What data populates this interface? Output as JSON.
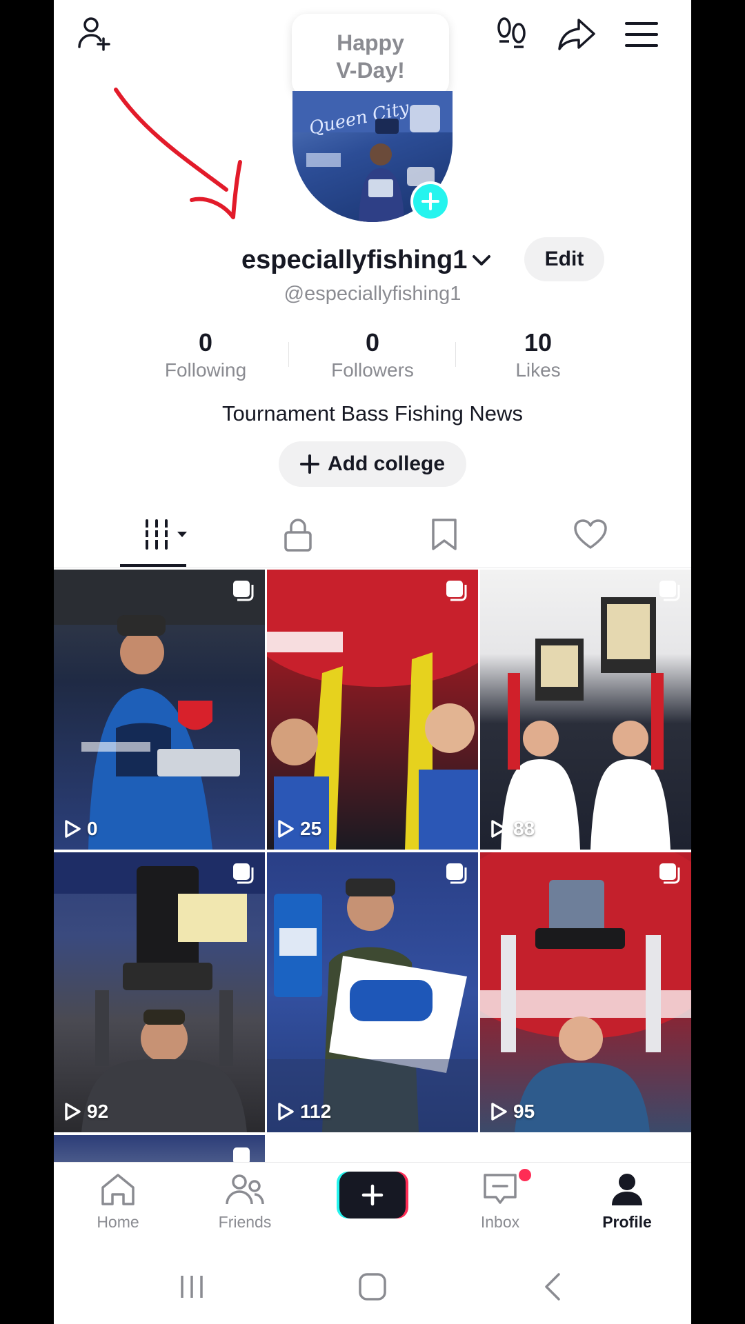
{
  "header": {
    "add_friend_icon": "person-plus-icon",
    "footprints_icon": "footprints-icon",
    "share_icon": "share-arrow-icon",
    "menu_icon": "hamburger-menu-icon",
    "bubble_line1": "Happy",
    "bubble_line2": "V-Day!"
  },
  "profile": {
    "display_name": "especiallyfishing1",
    "username": "@especiallyfishing1",
    "edit_label": "Edit",
    "bio": "Tournament Bass Fishing News",
    "add_college_label": "Add college",
    "stats": {
      "following_count": "0",
      "following_label": "Following",
      "followers_count": "0",
      "followers_label": "Followers",
      "likes_count": "10",
      "likes_label": "Likes"
    }
  },
  "tabs": [
    "videos-grid-icon",
    "lock-icon",
    "bookmark-icon",
    "heart-icon"
  ],
  "grid": [
    {
      "views": "0"
    },
    {
      "views": "25"
    },
    {
      "views": "88"
    },
    {
      "views": "92"
    },
    {
      "views": "112"
    },
    {
      "views": "95"
    }
  ],
  "bottom_nav": {
    "home": "Home",
    "friends": "Friends",
    "inbox": "Inbox",
    "profile": "Profile"
  },
  "colors": {
    "accent_cyan": "#25f4ee",
    "accent_red": "#fe2c55",
    "text_primary": "#161823",
    "text_secondary": "#8a8b91"
  }
}
